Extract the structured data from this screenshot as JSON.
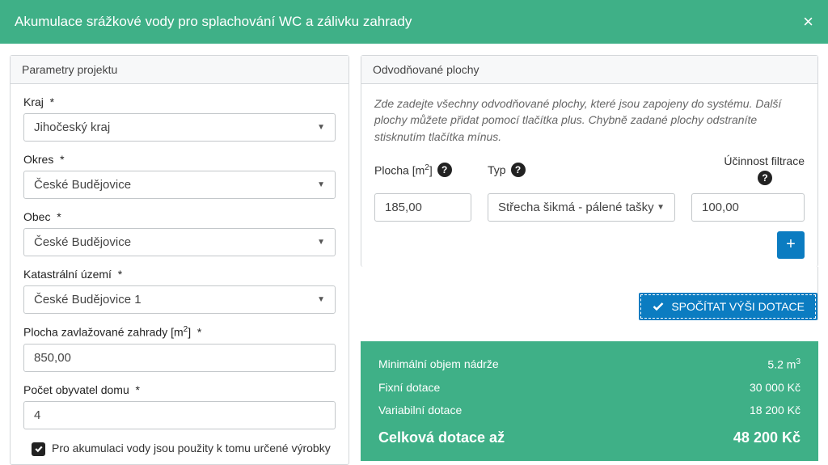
{
  "header": {
    "title": "Akumulace srážkové vody pro splachování WC a zálivku zahrady"
  },
  "left": {
    "panel_title": "Parametry projektu",
    "fields": {
      "kraj": {
        "label": "Kraj",
        "value": "Jihočeský kraj"
      },
      "okres": {
        "label": "Okres",
        "value": "České Budějovice"
      },
      "obec": {
        "label": "Obec",
        "value": "České Budějovice"
      },
      "katastr": {
        "label": "Katastrální území",
        "value": "České Budějovice 1"
      },
      "plocha_zahrady": {
        "label_pre": "Plocha zavlažované zahrady [m",
        "label_post": "]",
        "value": "850,00"
      },
      "obyvatel": {
        "label": "Počet obyvatel domu",
        "value": "4"
      }
    },
    "checkbox": {
      "label": "Pro akumulaci vody jsou použity k tomu určené výrobky",
      "checked": true
    }
  },
  "right": {
    "panel_title": "Odvodňované plochy",
    "help_text": "Zde zadejte všechny odvodňované plochy, které jsou zapojeny do systému. Další plochy můžete přidat pomocí tlačítka plus. Chybně zadané plochy odstraníte stisknutím tlačítka mínus.",
    "headers": {
      "plocha_pre": "Plocha [m",
      "plocha_post": "]",
      "typ": "Typ",
      "ucinnost": "Účinnost filtrace"
    },
    "row": {
      "plocha": "185,00",
      "typ": "Střecha šikmá - pálené tašky",
      "ucinnost": "100,00"
    },
    "calc_button": "SPOČÍTAT VÝŠI DOTACE"
  },
  "summary": {
    "rows": [
      {
        "label": "Minimální objem nádrže",
        "value_pre": "5.2 m",
        "value_sup": "3"
      },
      {
        "label": "Fixní dotace",
        "value": "30 000 Kč"
      },
      {
        "label": "Variabilní dotace",
        "value": "18 200 Kč"
      }
    ],
    "total": {
      "label": "Celková dotace až",
      "value": "48 200 Kč"
    }
  }
}
